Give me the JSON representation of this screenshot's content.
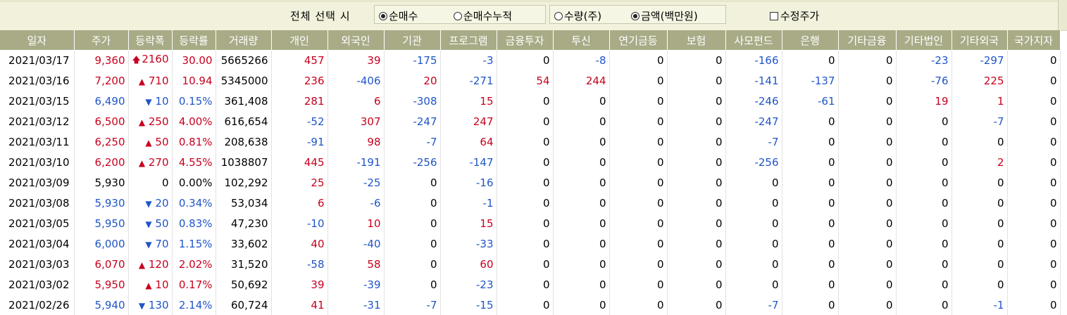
{
  "toolbar": {
    "select_all_label": "전체 선택 시",
    "group1": [
      {
        "label": "순매수",
        "checked": true
      },
      {
        "label": "순매수누적",
        "checked": false
      }
    ],
    "group2": [
      {
        "label": "수량(주)",
        "checked": false
      },
      {
        "label": "금액(백만원)",
        "checked": true
      }
    ],
    "adjusted_price_label": "수정주가"
  },
  "colors": {
    "header_bg": "#a8ab86",
    "toolbar_bg": "#f1f1dc",
    "up": "#c8001e",
    "down": "#1f55c8"
  },
  "icons": {
    "up_arrow": "▲",
    "big_up_arrow": "🡅",
    "down_arrow": "▼"
  },
  "columns": [
    "일자",
    "주가",
    "등락폭",
    "등락률",
    "거래량",
    "개인",
    "외국인",
    "기관",
    "프로그램",
    "금융투자",
    "투신",
    "연기금등",
    "보험",
    "사모펀드",
    "은행",
    "기타금융",
    "기타법인",
    "기타외국",
    "국가지자"
  ],
  "rows": [
    [
      "2021/03/17",
      "9,360",
      "bigup",
      "2160",
      "30.00",
      "5665266",
      "457",
      "39",
      "-175",
      "-3",
      "0",
      "-8",
      "0",
      "0",
      "-166",
      "0",
      "0",
      "-23",
      "-297",
      "0"
    ],
    [
      "2021/03/16",
      "7,200",
      "up",
      "710",
      "10.94",
      "5345000",
      "236",
      "-406",
      "20",
      "-271",
      "54",
      "244",
      "0",
      "0",
      "-141",
      "-137",
      "0",
      "-76",
      "225",
      "0"
    ],
    [
      "2021/03/15",
      "6,490",
      "down",
      "10",
      "0.15%",
      "361,408",
      "281",
      "6",
      "-308",
      "15",
      "0",
      "0",
      "0",
      "0",
      "-246",
      "-61",
      "0",
      "19",
      "1",
      "0"
    ],
    [
      "2021/03/12",
      "6,500",
      "up",
      "250",
      "4.00%",
      "616,654",
      "-52",
      "307",
      "-247",
      "247",
      "0",
      "0",
      "0",
      "0",
      "-247",
      "0",
      "0",
      "0",
      "-7",
      "0"
    ],
    [
      "2021/03/11",
      "6,250",
      "up",
      "50",
      "0.81%",
      "208,638",
      "-91",
      "98",
      "-7",
      "64",
      "0",
      "0",
      "0",
      "0",
      "-7",
      "0",
      "0",
      "0",
      "0",
      "0"
    ],
    [
      "2021/03/10",
      "6,200",
      "up",
      "270",
      "4.55%",
      "1038807",
      "445",
      "-191",
      "-256",
      "-147",
      "0",
      "0",
      "0",
      "0",
      "-256",
      "0",
      "0",
      "0",
      "2",
      "0"
    ],
    [
      "2021/03/09",
      "5,930",
      "none",
      "0",
      "0.00%",
      "102,292",
      "25",
      "-25",
      "0",
      "-16",
      "0",
      "0",
      "0",
      "0",
      "0",
      "0",
      "0",
      "0",
      "0",
      "0"
    ],
    [
      "2021/03/08",
      "5,930",
      "down",
      "20",
      "0.34%",
      "53,034",
      "6",
      "-6",
      "0",
      "-1",
      "0",
      "0",
      "0",
      "0",
      "0",
      "0",
      "0",
      "0",
      "0",
      "0"
    ],
    [
      "2021/03/05",
      "5,950",
      "down",
      "50",
      "0.83%",
      "47,230",
      "-10",
      "10",
      "0",
      "15",
      "0",
      "0",
      "0",
      "0",
      "0",
      "0",
      "0",
      "0",
      "0",
      "0"
    ],
    [
      "2021/03/04",
      "6,000",
      "down",
      "70",
      "1.15%",
      "33,602",
      "40",
      "-40",
      "0",
      "-33",
      "0",
      "0",
      "0",
      "0",
      "0",
      "0",
      "0",
      "0",
      "0",
      "0"
    ],
    [
      "2021/03/03",
      "6,070",
      "up",
      "120",
      "2.02%",
      "31,520",
      "-58",
      "58",
      "0",
      "60",
      "0",
      "0",
      "0",
      "0",
      "0",
      "0",
      "0",
      "0",
      "0",
      "0"
    ],
    [
      "2021/03/02",
      "5,950",
      "up",
      "10",
      "0.17%",
      "50,692",
      "39",
      "-39",
      "0",
      "-23",
      "0",
      "0",
      "0",
      "0",
      "0",
      "0",
      "0",
      "0",
      "0",
      "0"
    ],
    [
      "2021/02/26",
      "5,940",
      "down",
      "130",
      "2.14%",
      "60,724",
      "41",
      "-31",
      "-7",
      "-15",
      "0",
      "0",
      "0",
      "0",
      "-7",
      "0",
      "0",
      "0",
      "-1",
      "0"
    ]
  ]
}
